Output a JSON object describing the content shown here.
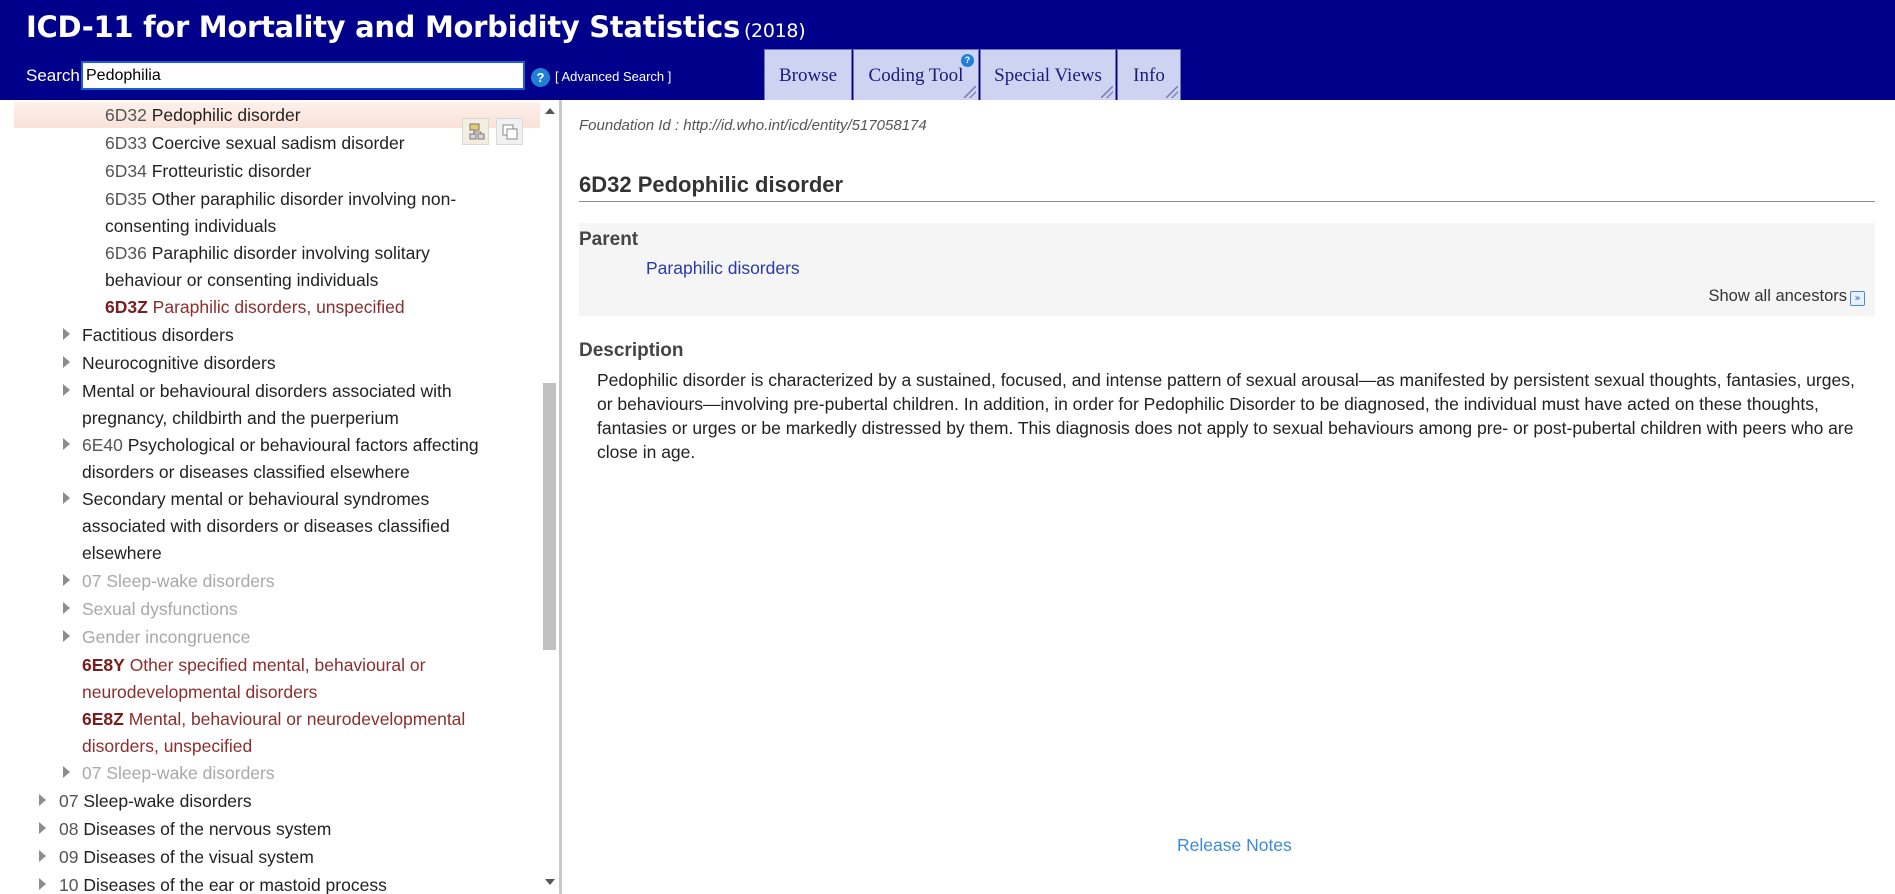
{
  "header": {
    "title": "ICD-11 for Mortality and Morbidity Statistics",
    "year": "(2018)",
    "search_label": "Search",
    "search_value": "Pedophilia",
    "help_glyph": "?",
    "advanced_search": "[ Advanced Search ]",
    "tabs": [
      {
        "label": "Browse"
      },
      {
        "label": "Coding Tool"
      },
      {
        "label": "Special Views"
      },
      {
        "label": "Info"
      }
    ],
    "colors": {
      "bar": "#00008b",
      "tab": "#cfd3f2"
    }
  },
  "tree": {
    "items": [
      {
        "code": "6D32",
        "label": "Pedophilic disorder",
        "lines": [
          "Pedophilic disorder"
        ],
        "style": "selected",
        "expander": false
      },
      {
        "code": "6D33",
        "label": "Coercive sexual sadism disorder",
        "style": "normal",
        "expander": false
      },
      {
        "code": "6D34",
        "label": "Frotteuristic disorder",
        "style": "normal",
        "expander": false
      },
      {
        "code": "6D35",
        "label_line1": "Other paraphilic disorder involving non-",
        "label_line2": "consenting individuals",
        "style": "normal",
        "expander": false
      },
      {
        "code": "6D36",
        "label_line1": "Paraphilic disorder involving solitary",
        "label_line2": "behaviour or consenting individuals",
        "style": "normal",
        "expander": false
      },
      {
        "code": "6D3Z",
        "label": "Paraphilic disorders, unspecified",
        "style": "red",
        "expander": false
      },
      {
        "code": "",
        "label": "Factitious disorders",
        "style": "normal",
        "expander": true
      },
      {
        "code": "",
        "label": "Neurocognitive disorders",
        "style": "normal",
        "expander": true
      },
      {
        "code": "",
        "label_line1": "Mental or behavioural disorders associated with",
        "label_line2": "pregnancy, childbirth and the puerperium",
        "style": "normal",
        "expander": true
      },
      {
        "code": "6E40",
        "label_line1": "Psychological or behavioural factors affecting",
        "label_line2": "disorders or diseases classified elsewhere",
        "style": "normal",
        "expander": true
      },
      {
        "code": "",
        "label_line1": "Secondary mental or behavioural syndromes",
        "label_line2": "associated with disorders or diseases classified",
        "label_line3": "elsewhere",
        "style": "normal",
        "expander": true
      },
      {
        "code": "07",
        "label": "Sleep-wake disorders",
        "style": "grey",
        "expander": true
      },
      {
        "code": "",
        "label": "Sexual dysfunctions",
        "style": "grey",
        "expander": true
      },
      {
        "code": "",
        "label": "Gender incongruence",
        "style": "grey",
        "expander": true
      },
      {
        "code": "6E8Y",
        "label_line1": "Other specified mental, behavioural or",
        "label_line2": "neurodevelopmental disorders",
        "style": "red",
        "expander": false
      },
      {
        "code": "6E8Z",
        "label_line1": "Mental, behavioural or neurodevelopmental",
        "label_line2": "disorders, unspecified",
        "style": "red",
        "expander": false
      },
      {
        "code": "07",
        "label": "Sleep-wake disorders",
        "style": "grey",
        "expander": true
      },
      {
        "code": "07",
        "label": "Sleep-wake disorders",
        "style": "normal",
        "expander": true
      },
      {
        "code": "08",
        "label": "Diseases of the nervous system",
        "style": "normal",
        "expander": true
      },
      {
        "code": "09",
        "label": "Diseases of the visual system",
        "style": "normal",
        "expander": true
      },
      {
        "code": "10",
        "label": "Diseases of the ear or mastoid process",
        "style": "normal",
        "expander": true
      }
    ]
  },
  "content": {
    "foundation_id": "Foundation Id : http://id.who.int/icd/entity/517058174",
    "title": "6D32 Pedophilic disorder",
    "parent_heading": "Parent",
    "parent_link": "Paraphilic disorders",
    "show_ancestors": "Show all ancestors",
    "description_heading": "Description",
    "description": "Pedophilic disorder is characterized by a sustained, focused, and intense pattern of sexual arousal—as manifested by persistent sexual thoughts, fantasies, urges, or behaviours—involving pre-pubertal children. In addition, in order for Pedophilic Disorder to be diagnosed, the individual must have acted on these thoughts, fantasies or urges or be markedly distressed by them. This diagnosis does not apply to sexual behaviours among pre- or post-pubertal children with peers who are close in age.",
    "release_notes": "Release Notes",
    "colors": {
      "link": "#2a3aa8",
      "release_link": "#3d8ad8",
      "red_code": "#7a1d1d"
    }
  }
}
